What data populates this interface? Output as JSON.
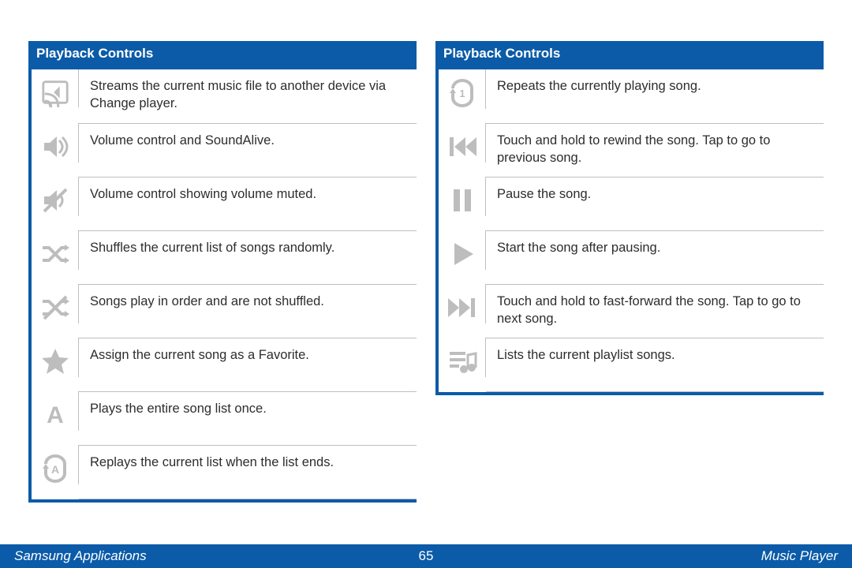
{
  "left": {
    "header": "Playback Controls",
    "rows": [
      {
        "icon": "cast-icon",
        "text": "Streams the current music file to another device via Change player."
      },
      {
        "icon": "volume-icon",
        "text": "Volume control and SoundAlive."
      },
      {
        "icon": "volume-muted-icon",
        "text": "Volume control showing volume muted."
      },
      {
        "icon": "shuffle-icon",
        "text": "Shuffles the current list of songs randomly."
      },
      {
        "icon": "shuffle-off-icon",
        "text": "Songs play in order and are not shuffled."
      },
      {
        "icon": "favorite-icon",
        "text": "Assign the current song as a Favorite."
      },
      {
        "icon": "play-all-once-icon",
        "text": "Plays the entire song list once."
      },
      {
        "icon": "replay-list-icon",
        "text": "Replays the current list when the list ends."
      }
    ]
  },
  "right": {
    "header": "Playback Controls",
    "rows": [
      {
        "icon": "repeat-one-icon",
        "text": "Repeats the currently playing song."
      },
      {
        "icon": "previous-icon",
        "text": "Touch and hold to rewind the song. Tap to go to previous song."
      },
      {
        "icon": "pause-icon",
        "text": "Pause the song."
      },
      {
        "icon": "play-icon",
        "text": "Start the song after pausing."
      },
      {
        "icon": "next-icon",
        "text": "Touch and hold to fast-forward the song. Tap to go to next song."
      },
      {
        "icon": "playlist-icon",
        "text": "Lists the current playlist songs."
      }
    ]
  },
  "footer": {
    "left": "Samsung Applications",
    "page": "65",
    "right": "Music Player"
  },
  "repeat_one_label": "1",
  "play_all_label": "A",
  "replay_label": "A"
}
